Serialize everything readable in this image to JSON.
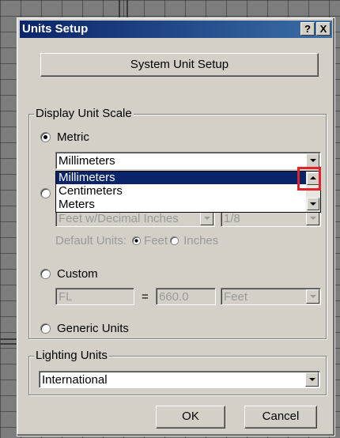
{
  "dialog": {
    "title": "Units Setup",
    "help_label": "?",
    "close_label": "X"
  },
  "system_unit_setup_label": "System Unit Setup",
  "display_unit_scale": {
    "group_label": "Display Unit Scale",
    "metric": {
      "label": "Metric",
      "selected": true,
      "combo_value": "Millimeters",
      "dropdown_options": [
        "Millimeters",
        "Centimeters",
        "Meters"
      ],
      "dropdown_selected": "Millimeters"
    },
    "us_standard": {
      "combo_value": "Feet w/Decimal Inches",
      "fraction_value": "1/8",
      "default_units_label": "Default Units:",
      "feet_label": "Feet",
      "inches_label": "Inches"
    },
    "custom": {
      "label": "Custom",
      "name_value": "FL",
      "equals": "=",
      "amount_value": "660.0",
      "unit_value": "Feet"
    },
    "generic": {
      "label": "Generic Units"
    }
  },
  "lighting_units": {
    "group_label": "Lighting Units",
    "value": "International"
  },
  "footer": {
    "ok_label": "OK",
    "cancel_label": "Cancel"
  },
  "colors": {
    "titlebar_start": "#0a246a",
    "titlebar_end": "#3a6ea5",
    "dialog_face": "#d4d0c8",
    "highlight": "#e0242a"
  }
}
